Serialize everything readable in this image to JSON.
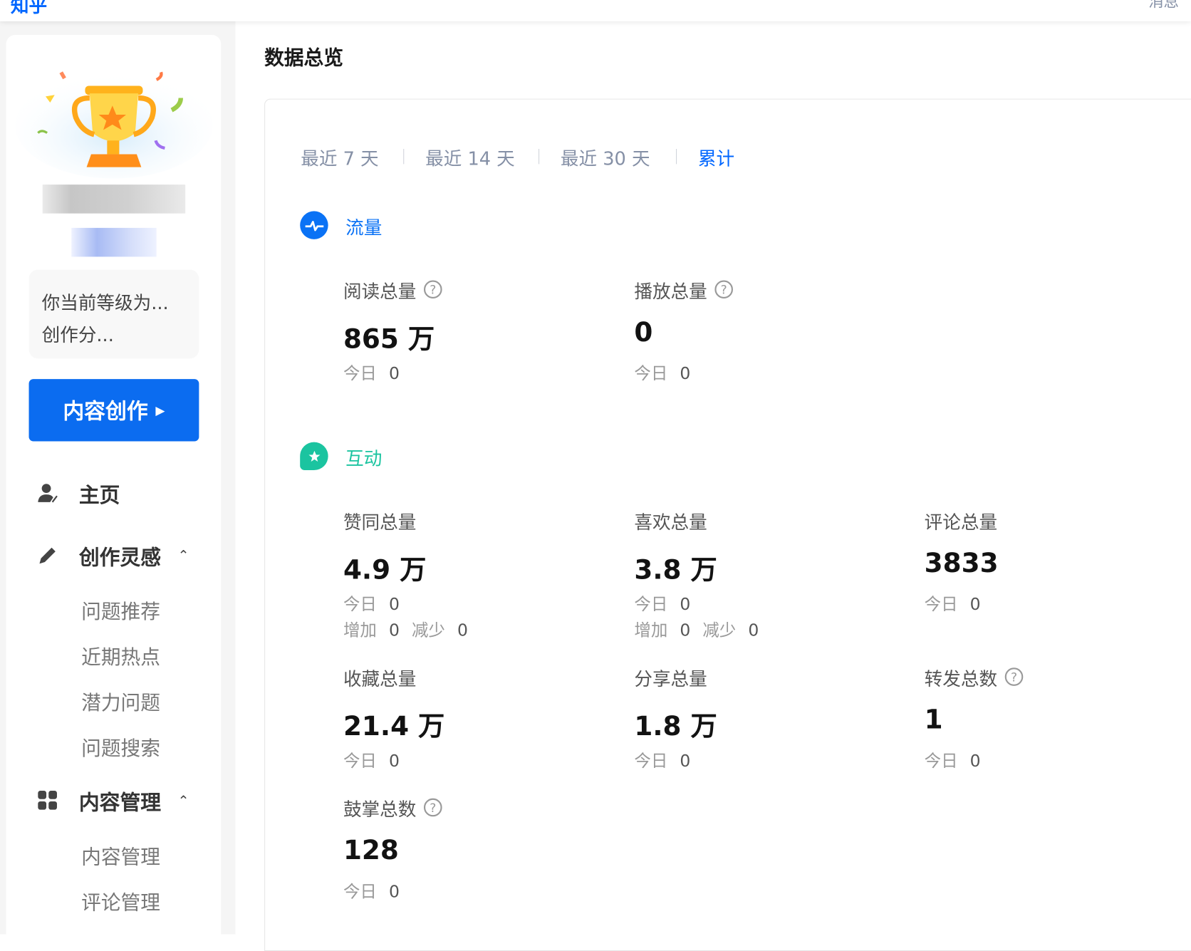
{
  "topbar": {
    "logo": "知乎",
    "messages": "消息"
  },
  "sidebar": {
    "level_line1": "你当前等级为...",
    "level_line2": "创作分...",
    "create_button": "内容创作",
    "nav": [
      {
        "label": "主页",
        "icon": "user-edit-icon"
      },
      {
        "label": "创作灵感",
        "icon": "pencil-icon",
        "expanded": true,
        "children": [
          "问题推荐",
          "近期热点",
          "潜力问题",
          "问题搜索"
        ]
      },
      {
        "label": "内容管理",
        "icon": "grid-icon",
        "expanded": true,
        "children": [
          "内容管理",
          "评论管理"
        ]
      }
    ]
  },
  "main": {
    "title": "数据总览",
    "tabs": [
      {
        "label": "最近 7 天"
      },
      {
        "label": "最近 14 天"
      },
      {
        "label": "最近 30 天"
      },
      {
        "label": "累计",
        "active": true
      }
    ],
    "today_label": "今日",
    "inc_label": "增加",
    "dec_label": "减少",
    "sections": [
      {
        "label": "流量",
        "color": "#0066ff",
        "icon": "pulse-icon",
        "stats": [
          {
            "label": "阅读总量",
            "help": true,
            "value": "865 万",
            "today": "0"
          },
          {
            "label": "播放总量",
            "help": true,
            "value": "0",
            "today": "0"
          }
        ]
      },
      {
        "label": "互动",
        "color": "#1bc4a0",
        "icon": "star-chat-icon",
        "stats": [
          {
            "label": "赞同总量",
            "value": "4.9 万",
            "today": "0",
            "inc": "0",
            "dec": "0"
          },
          {
            "label": "喜欢总量",
            "value": "3.8 万",
            "today": "0",
            "inc": "0",
            "dec": "0"
          },
          {
            "label": "评论总量",
            "value": "3833",
            "today": "0"
          },
          {
            "label": "收藏总量",
            "value": "21.4 万",
            "today": "0"
          },
          {
            "label": "分享总量",
            "value": "1.8 万",
            "today": "0"
          },
          {
            "label": "转发总数",
            "help": true,
            "value": "1",
            "today": "0"
          },
          {
            "label": "鼓掌总数",
            "help": true,
            "value": "128",
            "today": "0"
          }
        ]
      }
    ]
  }
}
